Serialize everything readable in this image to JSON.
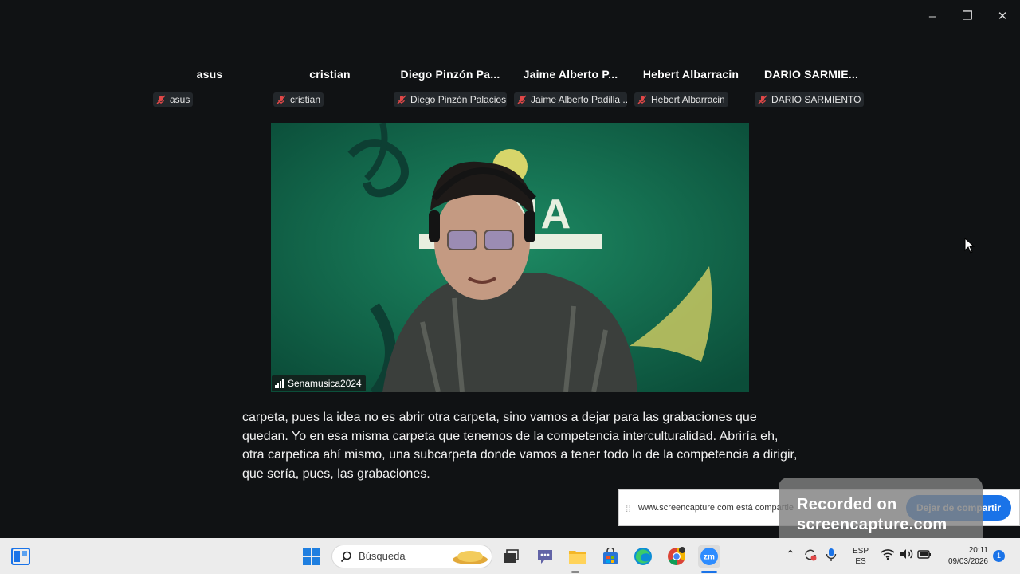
{
  "window_controls": {
    "minimize": "–",
    "restore": "❐",
    "close": "✕"
  },
  "participants": [
    {
      "name": "asus",
      "tag": "asus"
    },
    {
      "name": "cristian",
      "tag": "cristian"
    },
    {
      "name": "Diego  Pinzón  Pa...",
      "tag": "Diego Pinzón Palacios"
    },
    {
      "name": "Jaime  Alberto  P...",
      "tag": "Jaime Alberto Padilla ..."
    },
    {
      "name": "Hebert  Albarracin",
      "tag": "Hebert Albarracin"
    },
    {
      "name": "DARIO  SARMIE...",
      "tag": "DARIO SARMIENTO"
    }
  ],
  "active_speaker": {
    "name": "Senamusica2024",
    "background_text": "SENA"
  },
  "caption": "carpeta, pues la idea no es abrir otra carpeta, sino vamos a dejar para las grabaciones que quedan. Yo en esa misma carpeta que tenemos de la competencia interculturalidad. Abriría eh, otra carpetica ahí mismo, una subcarpeta donde vamos a tener todo lo de la competencia a dirigir, que sería, pues, las grabaciones.",
  "share_bar": {
    "text": "www.screencapture.com está compartie",
    "stop_label": "Dejar de compartir"
  },
  "watermark": {
    "line1": "Recorded on",
    "line2": "screencapture.com"
  },
  "taskbar": {
    "search_placeholder": "Búsqueda",
    "lang_top": "ESP",
    "lang_bottom": "ES",
    "time": "20:11",
    "date": "09/03/2026",
    "notification_count": "1"
  },
  "colors": {
    "accent": "#1a73e8",
    "muted_mic": "#e04848",
    "video_bg": "#0f5d45"
  }
}
